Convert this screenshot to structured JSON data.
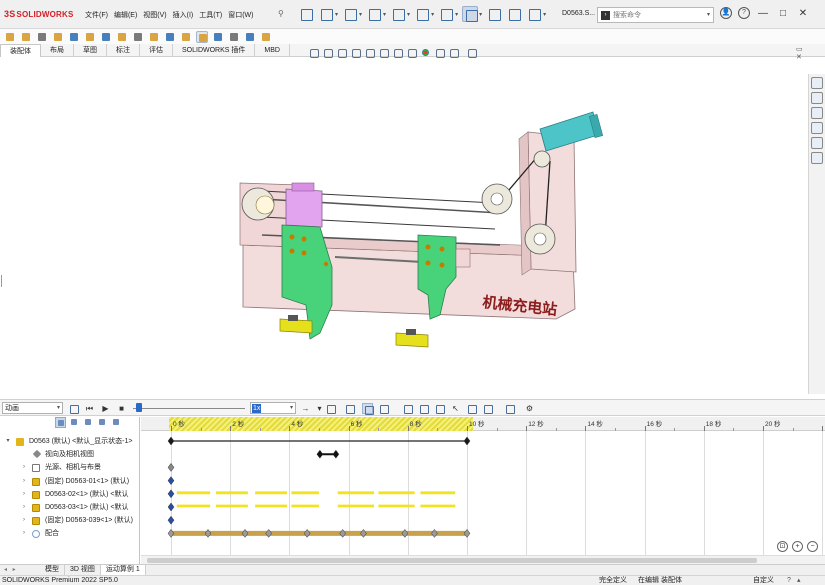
{
  "app": {
    "logo_ds": "3S",
    "logo_text": "SOLIDWORKS",
    "document_name": "D0563.S..."
  },
  "menu": [
    "文件(F)",
    "编辑(E)",
    "视图(V)",
    "插入(I)",
    "工具(T)",
    "窗口(W)"
  ],
  "search": {
    "placeholder": "搜索命令"
  },
  "command_tabs": [
    {
      "label": "装配体",
      "active": true
    },
    {
      "label": "布局",
      "active": false
    },
    {
      "label": "草图",
      "active": false
    },
    {
      "label": "标注",
      "active": false
    },
    {
      "label": "评估",
      "active": false
    },
    {
      "label": "SOLIDWORKS 插件",
      "active": false
    },
    {
      "label": "MBD",
      "active": false
    }
  ],
  "model": {
    "watermark": "机械充电站",
    "colors": {
      "frame": "#f3dcdc",
      "bracket": "#48d37a",
      "motor": "#4cc4c8",
      "clamp": "#e2a4ee",
      "foot": "#e6e01c",
      "pulley": "#ece9dc"
    }
  },
  "motion_manager": {
    "study_type": "动画",
    "playback_speed": "1x",
    "time_labels": [
      "0 秒",
      "2 秒",
      "4 秒",
      "6 秒",
      "8 秒",
      "10 秒",
      "12 秒",
      "14 秒",
      "16 秒",
      "18 秒",
      "20 秒"
    ],
    "animation_end_seconds": 10,
    "tree": [
      {
        "label": "D0563 (默认) <默认_显示状态-1>",
        "level": 0,
        "icon": "assembly-icon",
        "expand": "▾"
      },
      {
        "label": "视向及相机视图",
        "level": 1,
        "icon": "camera-icon",
        "expand": ""
      },
      {
        "label": "光源、相机与布景",
        "level": 1,
        "icon": "light-icon",
        "expand": "›"
      },
      {
        "label": "(固定) D0563-01<1> (默认)",
        "level": 1,
        "icon": "part-icon",
        "expand": "›"
      },
      {
        "label": "D0563-02<1> (默认) <默认",
        "level": 1,
        "icon": "part-icon",
        "expand": "›"
      },
      {
        "label": "D0563-03<1> (默认) <默认",
        "level": 1,
        "icon": "part-icon",
        "expand": "›"
      },
      {
        "label": "(固定) D0563-039<1> (默认)",
        "level": 1,
        "icon": "part-icon",
        "expand": "›"
      },
      {
        "label": "配合",
        "level": 1,
        "icon": "mate-icon",
        "expand": "›"
      }
    ]
  },
  "bottom_tabs": [
    {
      "label": "模型",
      "active": false
    },
    {
      "label": "3D 视图",
      "active": false
    },
    {
      "label": "运动算例 1",
      "active": true
    }
  ],
  "status": {
    "product": "SOLIDWORKS Premium 2022 SP5.0",
    "definition": "完全定义",
    "editing": "在编辑 装配体",
    "custom": "自定义"
  }
}
